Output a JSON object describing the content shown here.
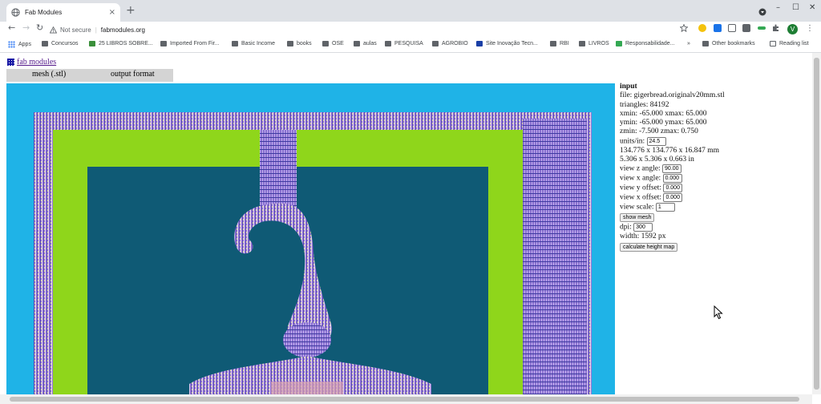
{
  "browser": {
    "tab_title": "Fab Modules",
    "tab_close": "×",
    "new_tab": "+",
    "nav": {
      "back": "←",
      "forward": "→",
      "reload": "↻"
    },
    "address": {
      "security_label": "Not secure",
      "url": "fabmodules.org"
    },
    "window_controls": {
      "minimize": "–",
      "maximize": "☐",
      "close": "✕"
    },
    "profile_initial": "V",
    "bookmarks": [
      {
        "label": "Apps",
        "icon": "apps-icon"
      },
      {
        "label": "Concursos",
        "icon": "folder-icon"
      },
      {
        "label": "25 LIBROS SOBRE...",
        "icon": "book-icon"
      },
      {
        "label": "Imported From Fir...",
        "icon": "folder-icon"
      },
      {
        "label": "Basic Income",
        "icon": "folder-icon"
      },
      {
        "label": "books",
        "icon": "folder-icon"
      },
      {
        "label": "OSE",
        "icon": "folder-icon"
      },
      {
        "label": "aulas",
        "icon": "folder-icon"
      },
      {
        "label": "PESQUISA",
        "icon": "folder-icon"
      },
      {
        "label": "AGROBIO",
        "icon": "folder-icon"
      },
      {
        "label": "Site Inovação Tecn...",
        "icon": "site-icon"
      },
      {
        "label": "RBI",
        "icon": "folder-icon"
      },
      {
        "label": "LIVROS",
        "icon": "folder-icon"
      },
      {
        "label": "Responsabilidade...",
        "icon": "drive-icon"
      }
    ],
    "bookmarks_overflow": "»",
    "other_bookmarks": "Other bookmarks",
    "reading_list": "Reading list"
  },
  "page": {
    "title": "fab modules",
    "menu": {
      "input": "mesh (.stl)",
      "output": "output format"
    }
  },
  "panel": {
    "heading": "input",
    "file": "file: gigerbread.originalv20mm.stl",
    "triangles": "triangles: 84192",
    "xrange": "xmin: -65.000 xmax: 65.000",
    "yrange": "ymin: -65.000 ymax: 65.000",
    "zrange": "zmin: -7.500 zmax: 0.750",
    "units_label": "units/in:",
    "units_value": "24.5",
    "size_mm": "134.776 x 134.776 x 16.847 mm",
    "size_in": "5.306 x 5.306 x 0.663 in",
    "view_z_angle_label": "view z angle:",
    "view_z_angle_value": "90.00",
    "view_x_angle_label": "view x angle:",
    "view_x_angle_value": "0.000",
    "view_y_offset_label": "view y offset:",
    "view_y_offset_value": "0.000",
    "view_x_offset_label": "view x offset:",
    "view_x_offset_value": "0.000",
    "view_scale_label": "view scale:",
    "view_scale_value": "1",
    "show_mesh_button": "show mesh",
    "dpi_label": "dpi:",
    "dpi_value": "300",
    "width": "width: 1592 px",
    "calc_button": "calculate height map"
  },
  "colors": {
    "canvas_bg": "#1fb3e7",
    "frame_green": "#8fd61b",
    "inner_teal": "#0f5a75",
    "mesh_purple": "#9a7ad6"
  }
}
